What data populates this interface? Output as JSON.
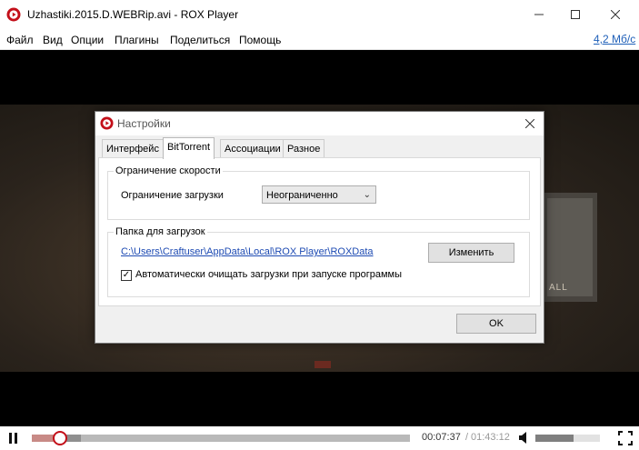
{
  "window": {
    "title": "Uzhastiki.2015.D.WEBRip.avi - ROX Player",
    "logo_icon": "rox-player-logo-icon",
    "controls": [
      "minimize-icon",
      "maximize-icon",
      "close-icon"
    ]
  },
  "menu": {
    "items": [
      "Файл",
      "Вид",
      "Опции",
      "Плагины",
      "Поделиться",
      "Помощь"
    ],
    "download_speed": "4,2 Мб/с"
  },
  "video": {
    "poster_text": "ALL"
  },
  "dialog": {
    "title": "Настройки",
    "tabs": [
      {
        "label": "Интерфейс",
        "active": false
      },
      {
        "label": "BitTorrent",
        "active": true
      },
      {
        "label": "Ассоциации",
        "active": false
      },
      {
        "label": "Разное",
        "active": false
      }
    ],
    "speed_group": {
      "title": "Ограничение скорости",
      "download_limit_label": "Ограничение загрузки",
      "download_limit_value": "Неограниченно"
    },
    "folder_group": {
      "title": "Папка для загрузок",
      "path": "C:\\Users\\Craftuser\\AppData\\Local\\ROX Player\\ROXData",
      "change_label": "Изменить",
      "autoclean_label": "Автоматически очищать загрузки при запуске программы",
      "autoclean_checked": true
    },
    "ok_label": "OK"
  },
  "playback": {
    "current_time": "00:07:37",
    "separator": "/",
    "total_time": "01:43:12",
    "progress_fraction": 0.074,
    "buffered_fraction": 0.13,
    "volume_fraction": 0.59,
    "accent_color": "#c30f19"
  }
}
